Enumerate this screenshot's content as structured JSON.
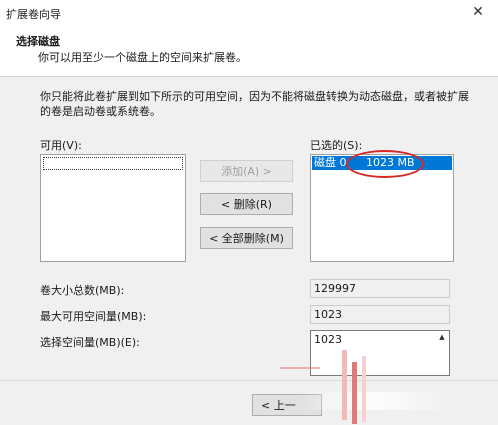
{
  "window": {
    "title": "扩展卷向导",
    "close_glyph": "✕"
  },
  "header": {
    "title": "选择磁盘",
    "subtitle": "你可以用至少一个磁盘上的空间来扩展卷。"
  },
  "description": "你只能将此卷扩展到如下所示的可用空间，因为不能将磁盘转换为动态磁盘，或者被扩展的卷是启动卷或系统卷。",
  "available": {
    "label": "可用(V):",
    "items": []
  },
  "selected": {
    "label": "已选的(S):",
    "items": [
      {
        "disk": "磁盘 0",
        "size": "1023 MB"
      }
    ]
  },
  "buttons": {
    "add": "添加(A) >",
    "remove": "< 删除(R)",
    "remove_all": "< 全部删除(M)",
    "back": "< 上一"
  },
  "fields": {
    "total_size_label": "卷大小总数(MB):",
    "total_size_value": "129997",
    "max_space_label": "最大可用空间量(MB):",
    "max_space_value": "1023",
    "select_space_label": "选择空间量(MB)(E):",
    "select_space_value": "1023"
  },
  "colors": {
    "selection": "#0078d7",
    "annotation_red": "#d62a2a"
  }
}
